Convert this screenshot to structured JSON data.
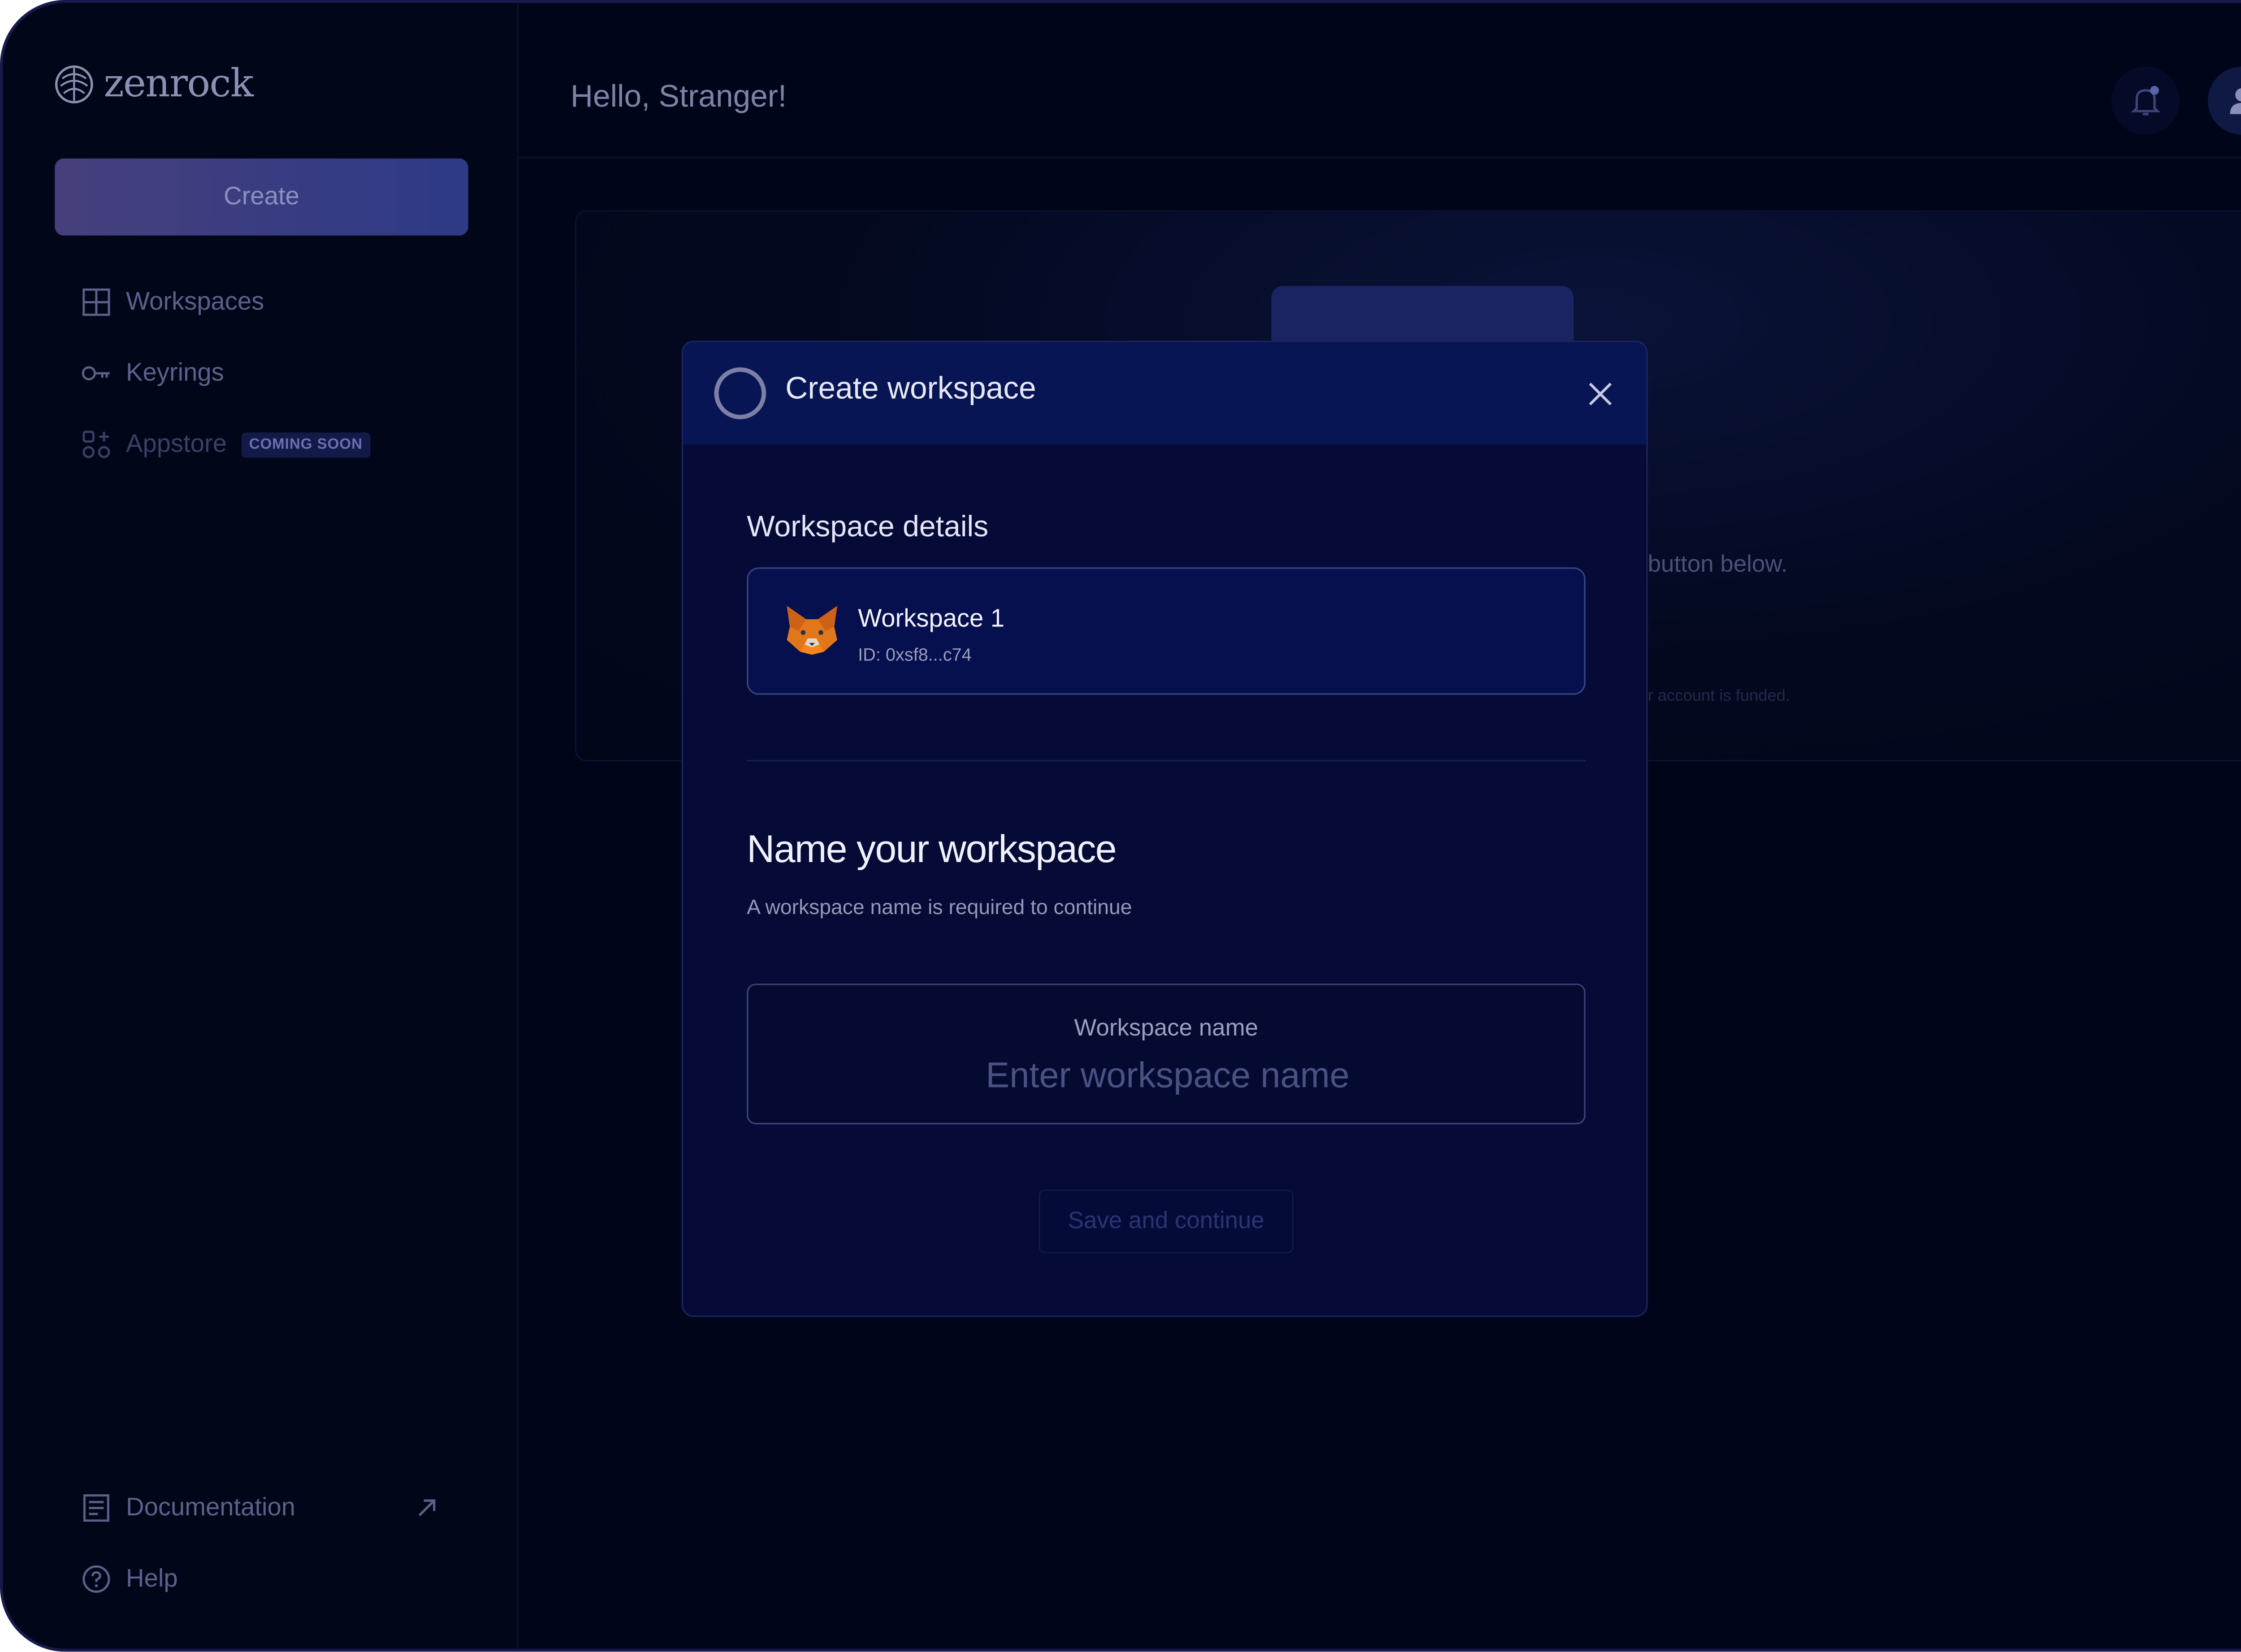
{
  "app": {
    "logo_text": "zenrock",
    "greeting": "Hello, Stranger!"
  },
  "sidebar": {
    "create_label": "Create",
    "items": [
      {
        "label": "Workspaces",
        "icon": "grid-icon"
      },
      {
        "label": "Keyrings",
        "icon": "key-icon"
      },
      {
        "label": "Appstore",
        "icon": "apps-icon",
        "badge": "COMING SOON"
      }
    ],
    "footer": [
      {
        "label": "Documentation",
        "icon": "document-icon"
      },
      {
        "label": "Help",
        "icon": "help-icon"
      }
    ]
  },
  "background": {
    "hint": "button below.",
    "note": "r account is funded."
  },
  "modal": {
    "title": "Create workspace",
    "details_title": "Workspace details",
    "workspace": {
      "name": "Workspace 1",
      "id": "ID: 0xsf8...c74",
      "avatar": "fox-icon"
    },
    "name_title": "Name your workspace",
    "name_subtitle": "A workspace name is required to continue",
    "input_label": "Workspace name",
    "input_placeholder": "Enter workspace name",
    "input_value": "",
    "save_label": "Save and continue"
  },
  "colors": {
    "background": "#01051a",
    "modal": "#050b36",
    "header": "#081554",
    "accent": "#2d3a86"
  }
}
